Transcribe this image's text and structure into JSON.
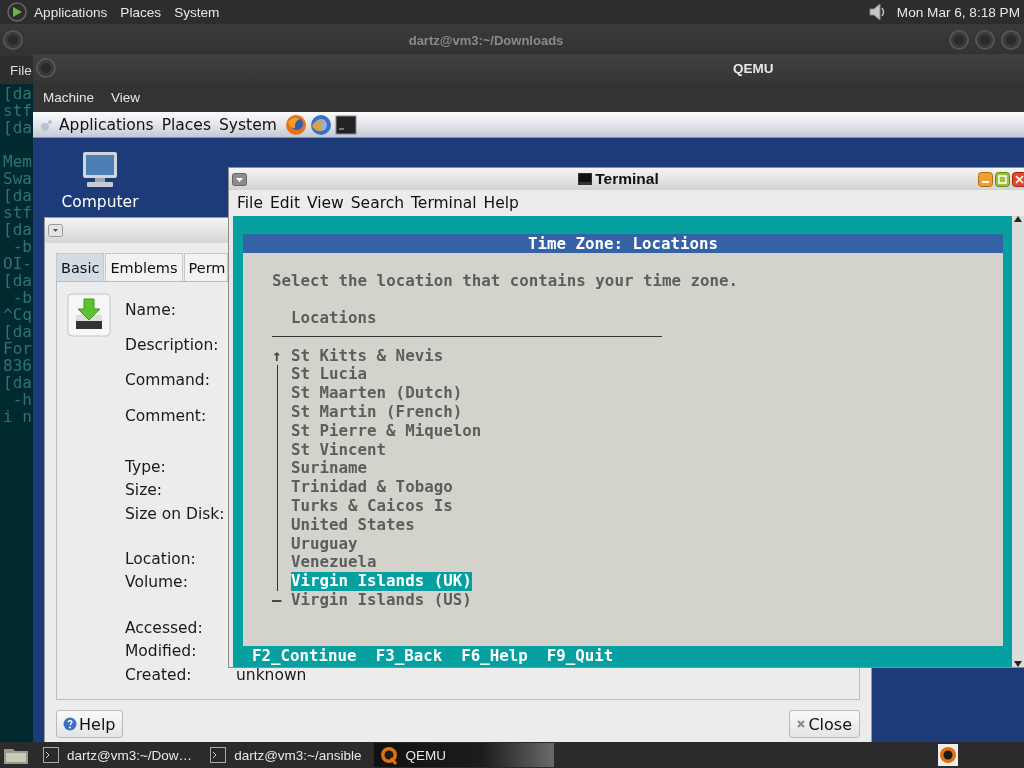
{
  "host_panel": {
    "menus": [
      "Applications",
      "Places",
      "System"
    ],
    "clock": "Mon Mar 6, 8:18 PM"
  },
  "host_terminal": {
    "title": "dartz@vm3:~/Downloads",
    "menus": [
      "File"
    ],
    "blocks": [
      [
        "[da",
        "stf",
        "[da"
      ],
      [
        "Mem",
        "Swa",
        "[da",
        "stf",
        "[da",
        " -b",
        "OI-",
        "[da",
        " -b",
        "^Cq",
        "[da",
        "For",
        "836",
        "[da",
        " -h",
        "i n"
      ]
    ]
  },
  "qemu": {
    "title": "QEMU",
    "menus": [
      "Machine",
      "View"
    ],
    "guest": {
      "panel": {
        "menus": [
          "Applications",
          "Places",
          "System"
        ]
      },
      "desktop_icons": [
        {
          "label": "Computer"
        }
      ],
      "properties": {
        "tabs": [
          {
            "label": "Basic",
            "selected": true
          },
          {
            "label": "Emblems",
            "selected": false
          },
          {
            "label": "Perm",
            "selected": false
          }
        ],
        "field_groups": [
          [
            {
              "label": "Name:"
            },
            {
              "label": "Description:"
            },
            {
              "label": "Command:"
            },
            {
              "label": "Comment:"
            }
          ],
          [
            {
              "label": "Type:"
            },
            {
              "label": "Size:"
            },
            {
              "label": "Size on Disk:"
            }
          ],
          [
            {
              "label": "Location:"
            },
            {
              "label": "Volume:"
            }
          ],
          [
            {
              "label": "Accessed:"
            },
            {
              "label": "Modified:"
            },
            {
              "label": "Created:",
              "value": "unknown"
            }
          ]
        ],
        "buttons": [
          {
            "label": "Help",
            "kind": "help"
          },
          {
            "label": "Close",
            "kind": "close"
          }
        ]
      },
      "terminal": {
        "title": "Terminal",
        "menus": [
          "File",
          "Edit",
          "View",
          "Search",
          "Terminal",
          "Help"
        ],
        "dialog": {
          "title": "Time Zone: Locations",
          "prompt": "Select the location that contains your time zone.",
          "list_header": "Locations",
          "scroll_up": "↑",
          "scroll_end": "—",
          "items": [
            {
              "label": "St Kitts & Nevis",
              "selected": false
            },
            {
              "label": "St Lucia",
              "selected": false
            },
            {
              "label": "St Maarten (Dutch)",
              "selected": false
            },
            {
              "label": "St Martin (French)",
              "selected": false
            },
            {
              "label": "St Pierre & Miquelon",
              "selected": false
            },
            {
              "label": "St Vincent",
              "selected": false
            },
            {
              "label": "Suriname",
              "selected": false
            },
            {
              "label": "Trinidad & Tobago",
              "selected": false
            },
            {
              "label": "Turks & Caicos Is",
              "selected": false
            },
            {
              "label": "United States",
              "selected": false
            },
            {
              "label": "Uruguay",
              "selected": false
            },
            {
              "label": "Venezuela",
              "selected": false
            },
            {
              "label": "Virgin Islands (UK)",
              "selected": true
            },
            {
              "label": "Virgin Islands (US)",
              "selected": false
            }
          ],
          "footer": [
            "F2_Continue",
            "F3_Back",
            "F6_Help",
            "F9_Quit"
          ]
        }
      }
    }
  },
  "taskbar": {
    "tasks": [
      {
        "label": "dartz@vm3:~/Dow…",
        "kind": "terminal",
        "selected": false
      },
      {
        "label": "dartz@vm3:~/ansible",
        "kind": "terminal",
        "selected": false
      },
      {
        "label": "QEMU",
        "kind": "qemu",
        "selected": true
      }
    ]
  }
}
